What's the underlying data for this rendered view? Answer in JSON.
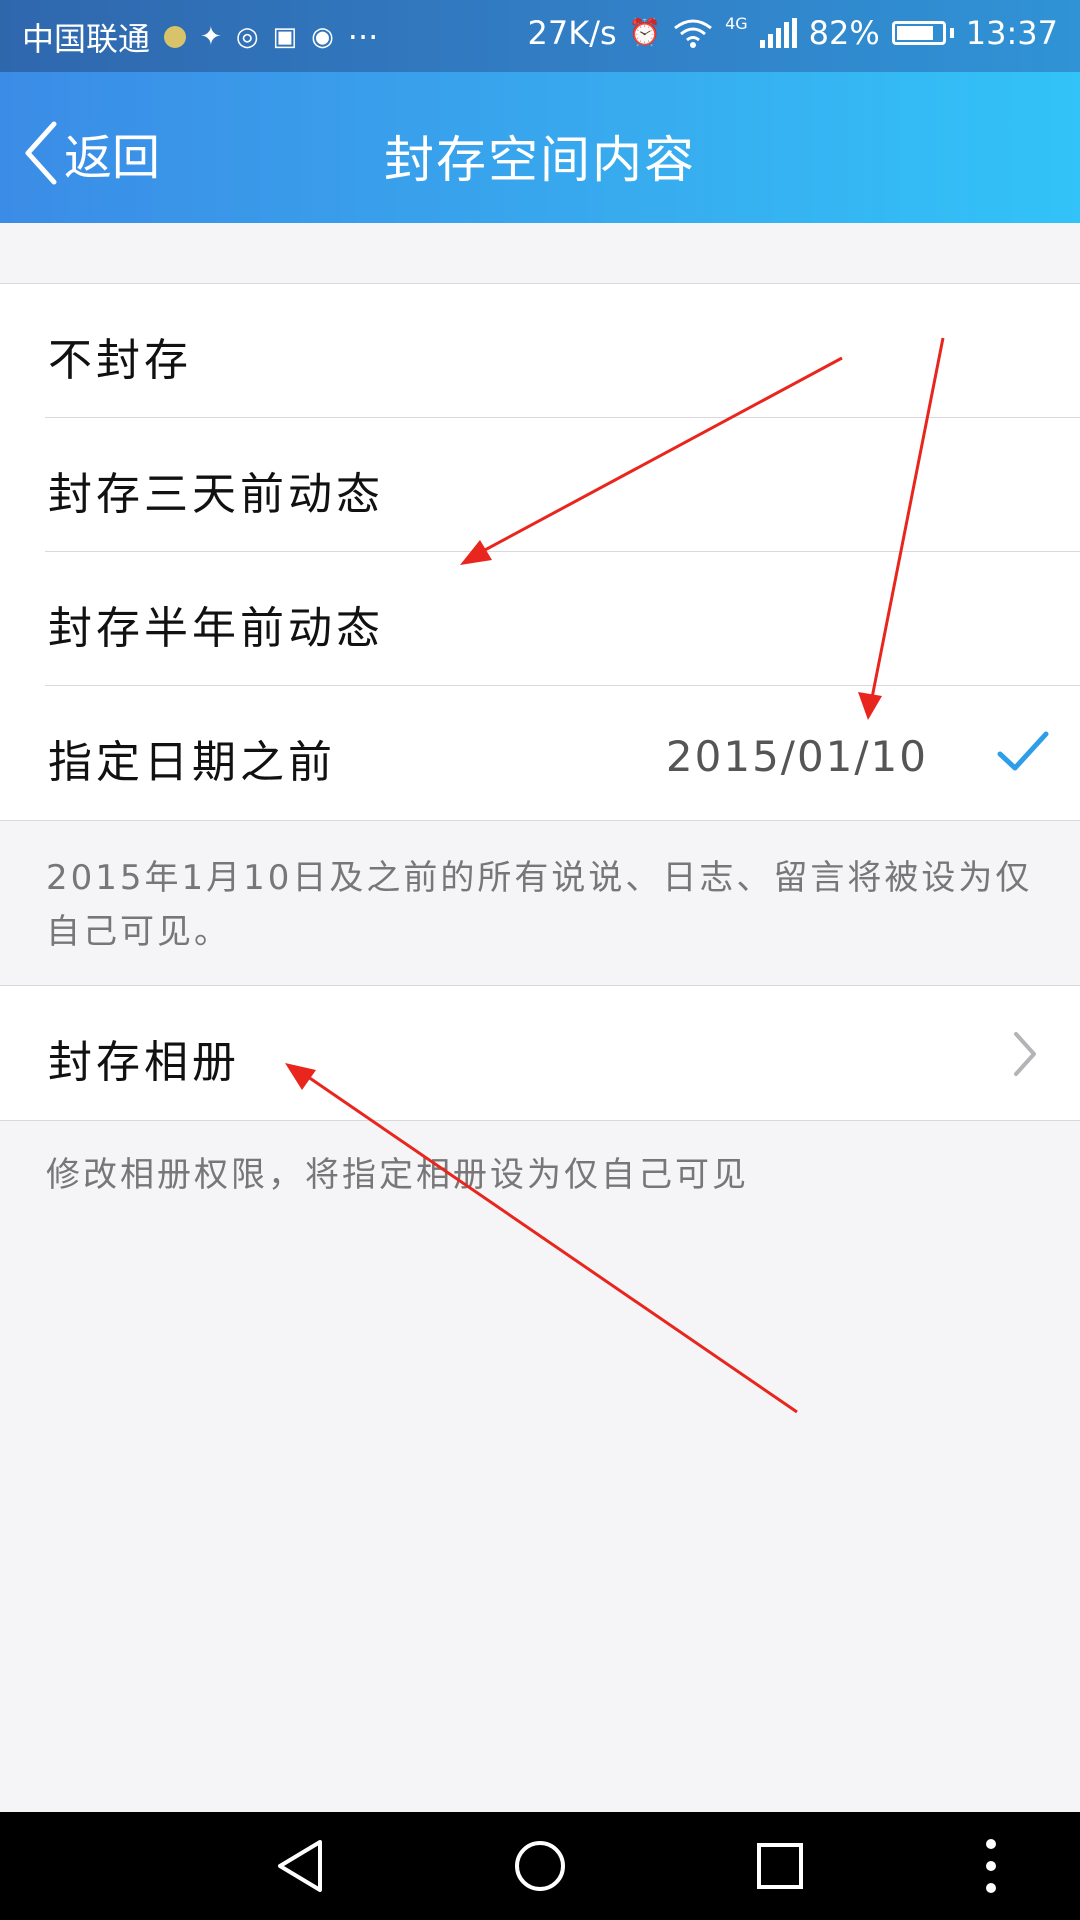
{
  "status_bar": {
    "carrier": "中国联通",
    "dots": "···",
    "speed": "27K/s",
    "network": "4G",
    "battery": "82%",
    "battery_level": 0.82,
    "time": "13:37"
  },
  "header": {
    "back_label": "返回",
    "title": "封存空间内容"
  },
  "options": [
    {
      "label": "不封存"
    },
    {
      "label": "封存三天前动态"
    },
    {
      "label": "封存半年前动态"
    },
    {
      "label": "指定日期之前",
      "value": "2015/01/10",
      "selected": true
    }
  ],
  "options_note": "2015年1月10日及之前的所有说说、日志、留言将被设为仅自己可见。",
  "album": {
    "label": "封存相册",
    "note": "修改相册权限，将指定相册设为仅自己可见"
  },
  "colors": {
    "header_start": "#3b8ce6",
    "header_end": "#32c3f8",
    "check": "#2f9ee8",
    "annotation_arrow": "#e8261d"
  },
  "icons": [
    "back-chevron-icon",
    "check-icon",
    "chevron-right-icon",
    "alarm-icon",
    "wifi-icon",
    "signal-icon",
    "battery-icon",
    "nav-back-icon",
    "nav-home-icon",
    "nav-recents-icon",
    "nav-menu-icon"
  ]
}
